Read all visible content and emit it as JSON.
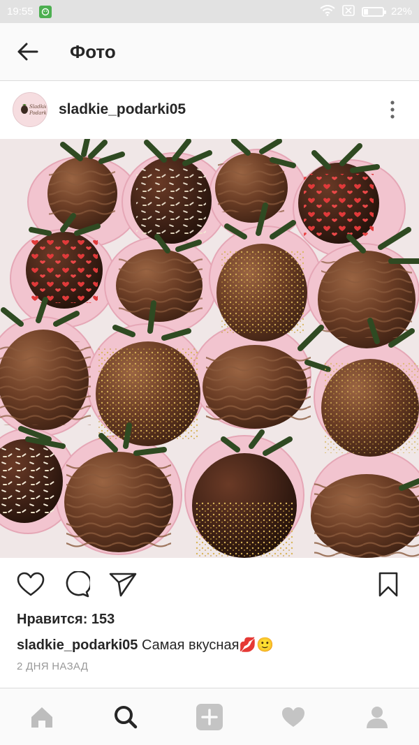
{
  "status_bar": {
    "time": "19:55",
    "battery": "22%",
    "battery_level": 0.22,
    "icons": [
      "app-notification-icon",
      "wifi-icon",
      "sim-icon",
      "battery-icon"
    ]
  },
  "appbar": {
    "title": "Фото",
    "back_icon": "arrow-left-icon"
  },
  "post": {
    "username": "sladkie_podarki05",
    "avatar_text": "Sladkie Podarki",
    "photo_alt": "chocolate covered strawberries",
    "likes_label": "Нравится:",
    "likes_count": "153",
    "caption_user": "sladkie_podarki05",
    "caption_text": "Самая вкусная💋🙂",
    "timestamp": "2 ДНЯ НАЗАД"
  },
  "actions": [
    "heart-icon",
    "comment-icon",
    "share-icon",
    "bookmark-icon"
  ],
  "bottom_nav": [
    "home-icon",
    "search-icon",
    "add-icon",
    "activity-icon",
    "profile-icon"
  ],
  "colors": {
    "text": "#262626",
    "muted": "#999999",
    "bar": "#fafafa",
    "chocolate": "#5a3420",
    "gold": "#c9a64a"
  }
}
